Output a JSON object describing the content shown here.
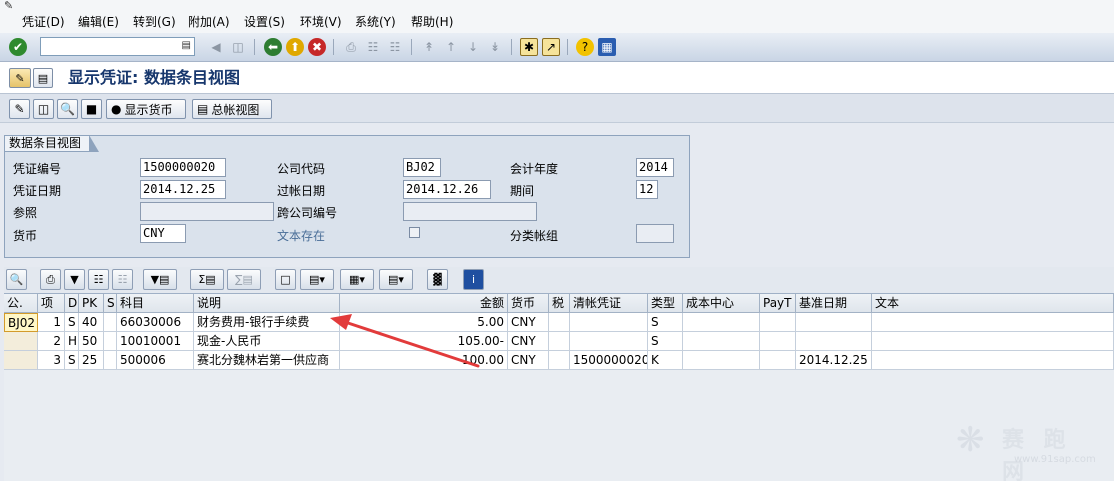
{
  "menubar": {
    "items": [
      "凭证(D)",
      "编辑(E)",
      "转到(G)",
      "附加(A)",
      "设置(S)",
      "环境(V)",
      "系统(Y)",
      "帮助(H)"
    ]
  },
  "toolbar": {
    "command_field": "",
    "icons": [
      "enter-icon",
      "save-icon",
      "back-icon",
      "exit-icon",
      "cancel-icon",
      "print-icon",
      "find-icon",
      "find-next-icon",
      "first-page-icon",
      "previous-page-icon",
      "next-page-icon",
      "last-page-icon",
      "create-session-icon",
      "shortcut-icon",
      "help-icon",
      "customize-icon"
    ]
  },
  "title": "显示凭证: 数据条目视图",
  "app_toolbar": {
    "display_currency": "显示货币",
    "general_ledger_view": "总帐视图"
  },
  "header": {
    "group_title": "数据条目视图",
    "doc_number_label": "凭证编号",
    "doc_number": "1500000020",
    "company_code_label": "公司代码",
    "company_code": "BJ02",
    "fiscal_year_label": "会计年度",
    "fiscal_year": "2014",
    "doc_date_label": "凭证日期",
    "doc_date": "2014.12.25",
    "posting_date_label": "过帐日期",
    "posting_date": "2014.12.26",
    "period_label": "期间",
    "period": "12",
    "reference_label": "参照",
    "reference": "",
    "cross_company_label": "跨公司编号",
    "cross_company": "",
    "currency_label": "货币",
    "currency": "CNY",
    "text_exists_label": "文本存在",
    "ledger_group_label": "分类帐组",
    "ledger_group": ""
  },
  "grid": {
    "columns": [
      "公.",
      "项",
      "D",
      "PK",
      "S",
      "科目",
      "说明",
      "金额",
      "货币",
      "税",
      "清帐凭证",
      "类型",
      "成本中心",
      "PayT",
      "基准日期",
      "文本"
    ],
    "rows": [
      [
        "BJ02",
        "1",
        "S",
        "40",
        "",
        "66030006",
        "财务费用-银行手续费",
        "5.00",
        "CNY",
        "",
        "",
        "S",
        "",
        "",
        "",
        ""
      ],
      [
        "",
        "2",
        "H",
        "50",
        "",
        "10010001",
        "现金-人民币",
        "105.00-",
        "CNY",
        "",
        "",
        "S",
        "",
        "",
        "",
        ""
      ],
      [
        "",
        "3",
        "S",
        "25",
        "",
        "500006",
        "赛北分魏林岩第一供应商",
        "100.00",
        "CNY",
        "",
        "1500000020",
        "K",
        "",
        "",
        "2014.12.25",
        ""
      ]
    ]
  },
  "watermark": {
    "text": "赛 跑 网",
    "url": "www.91sap.com"
  }
}
